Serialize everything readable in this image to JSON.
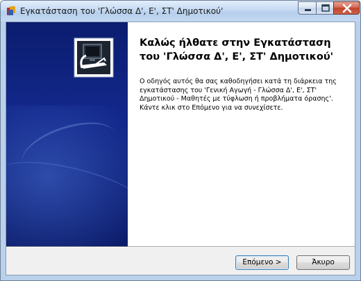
{
  "window": {
    "title": "Εγκατάσταση του 'Γλώσσα Δ', Ε', ΣΤ' Δημοτικού'",
    "controls": [
      "minimize-icon",
      "maximize-icon",
      "close-icon"
    ]
  },
  "sidebar": {
    "logo_icon": "installer-computer-icon"
  },
  "main": {
    "heading": "Καλώς ήλθατε στην Εγκατάσταση του 'Γλώσσα Δ', Ε', ΣΤ' Δημοτικού'",
    "body": "Ο οδηγός αυτός θα σας καθοδηγήσει κατά τη διάρκεια της εγκατάστασης του 'Γενική Αγωγή - Γλώσσα Δ', Ε', ΣΤ' Δημοτικού - Μαθητές με τύφλωση ή προβλήματα όρασης'. Κάντε κλικ στο Επόμενο για να συνεχίσετε."
  },
  "buttons": {
    "next_label": "Επόμενο >",
    "cancel_label": "Άκυρο"
  }
}
